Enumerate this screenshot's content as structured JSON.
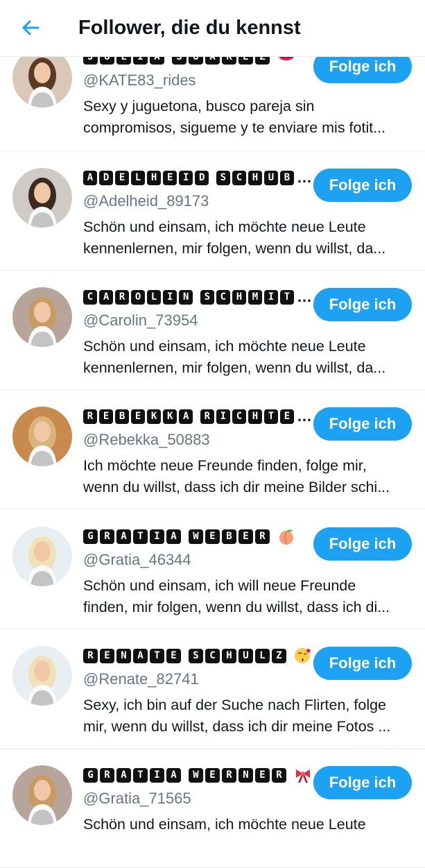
{
  "header": {
    "title": "Follower, die du kennst",
    "back_icon": "arrow-left-icon",
    "accent": "#1da1f2"
  },
  "follow_label": "Folge ich",
  "users": [
    {
      "name": "JULIA SUAREZ",
      "name_truncated": false,
      "emoji": "kiss-lips-icon",
      "handle": "@KATE83_rides",
      "bio1": "Sexy y juguetona, busco pareja sin",
      "bio2": "compromisos, sigueme y te enviare mis fotit...",
      "hair": "#5a3a22",
      "bg": "#d9c7b8"
    },
    {
      "name": "ADELHEID SCHUB",
      "name_truncated": true,
      "emoji": "lipstick-icon",
      "handle": "@Adelheid_89173",
      "bio1": "Schön und einsam, ich möchte neue Leute",
      "bio2": "kennenlernen, mir folgen, wenn du willst, da...",
      "hair": "#3b2a20",
      "bg": "#cfcac6"
    },
    {
      "name": "CAROLIN SCHMIT",
      "name_truncated": true,
      "emoji": "lipstick-icon",
      "handle": "@Carolin_73954",
      "bio1": "Schön und einsam, ich möchte neue Leute",
      "bio2": "kennenlernen, mir folgen, wenn du willst, da...",
      "hair": "#c99a62",
      "bg": "#b7a49a"
    },
    {
      "name": "REBEKKA RICHTE",
      "name_truncated": true,
      "emoji": "heart-icon",
      "handle": "@Rebekka_50883",
      "bio1": "Ich möchte neue Freunde finden, folge mir,",
      "bio2": "wenn du willst, dass ich dir meine Bilder schi...",
      "hair": "#d8b37a",
      "bg": "#c98a4e"
    },
    {
      "name": "GRATIA WEBER",
      "name_truncated": false,
      "emoji": "peach-icon",
      "handle": "@Gratia_46344",
      "bio1": "Schön und einsam, ich will neue Freunde",
      "bio2": "finden, mir folgen, wenn du willst, dass ich di...",
      "hair": "#f0e2b8",
      "bg": "#e9eef2"
    },
    {
      "name": "RENATE SCHULZ",
      "name_truncated": false,
      "emoji": "kiss-face-icon",
      "handle": "@Renate_82741",
      "bio1": "Sexy, ich bin auf der Suche nach Flirten, folge",
      "bio2": "mir, wenn du willst, dass ich dir meine Fotos ...",
      "hair": "#f0e2b8",
      "bg": "#e9eef2"
    },
    {
      "name": "GRATIA WERNER",
      "name_truncated": false,
      "emoji": "bow-icon",
      "handle": "@Gratia_71565",
      "bio1": "Schön und einsam, ich möchte neue Leute",
      "bio2": "",
      "hair": "#c99a62",
      "bg": "#b7a49a"
    }
  ]
}
